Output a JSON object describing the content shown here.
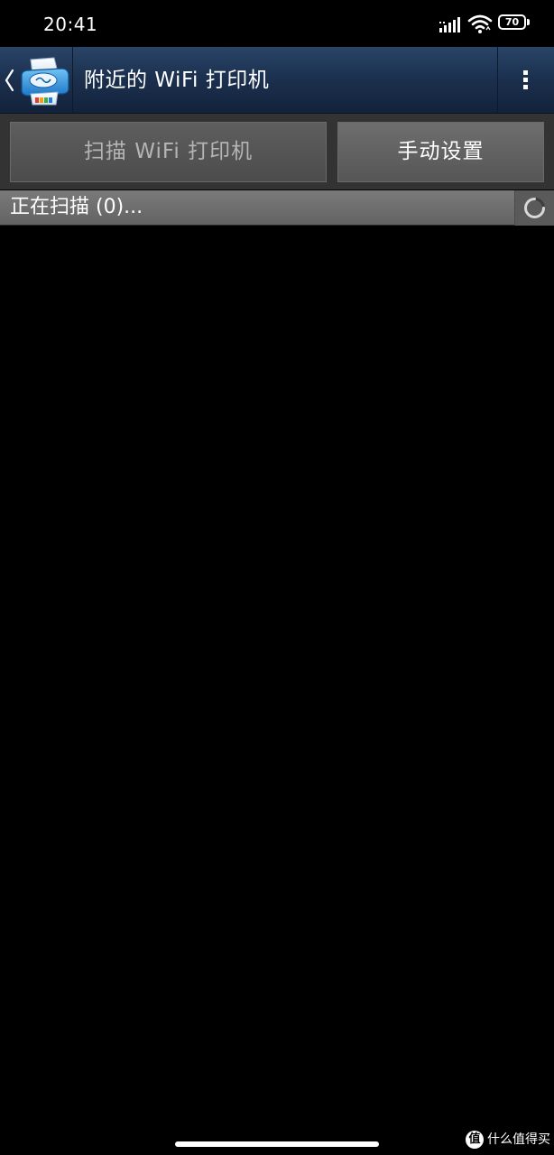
{
  "status_bar": {
    "time": "20:41",
    "battery_level": "70",
    "signal_icon": "cellular-signal-icon",
    "wifi_icon": "wifi-icon",
    "battery_icon": "battery-icon"
  },
  "action_bar": {
    "title": "附近的 WiFi 打印机",
    "back_icon": "chevron-left-icon",
    "logo_icon": "printer-app-logo",
    "overflow_icon": "more-vertical-icon",
    "background_color": "#1c3150"
  },
  "buttons": {
    "scan_label": "扫描 WiFi 打印机",
    "manual_label": "手动设置"
  },
  "scan_status": {
    "text": "正在扫描 (0)...",
    "spinner_icon": "loading-spinner-icon"
  },
  "printers": [],
  "watermark": {
    "icon_glyph": "值",
    "text": "什么值得买"
  }
}
